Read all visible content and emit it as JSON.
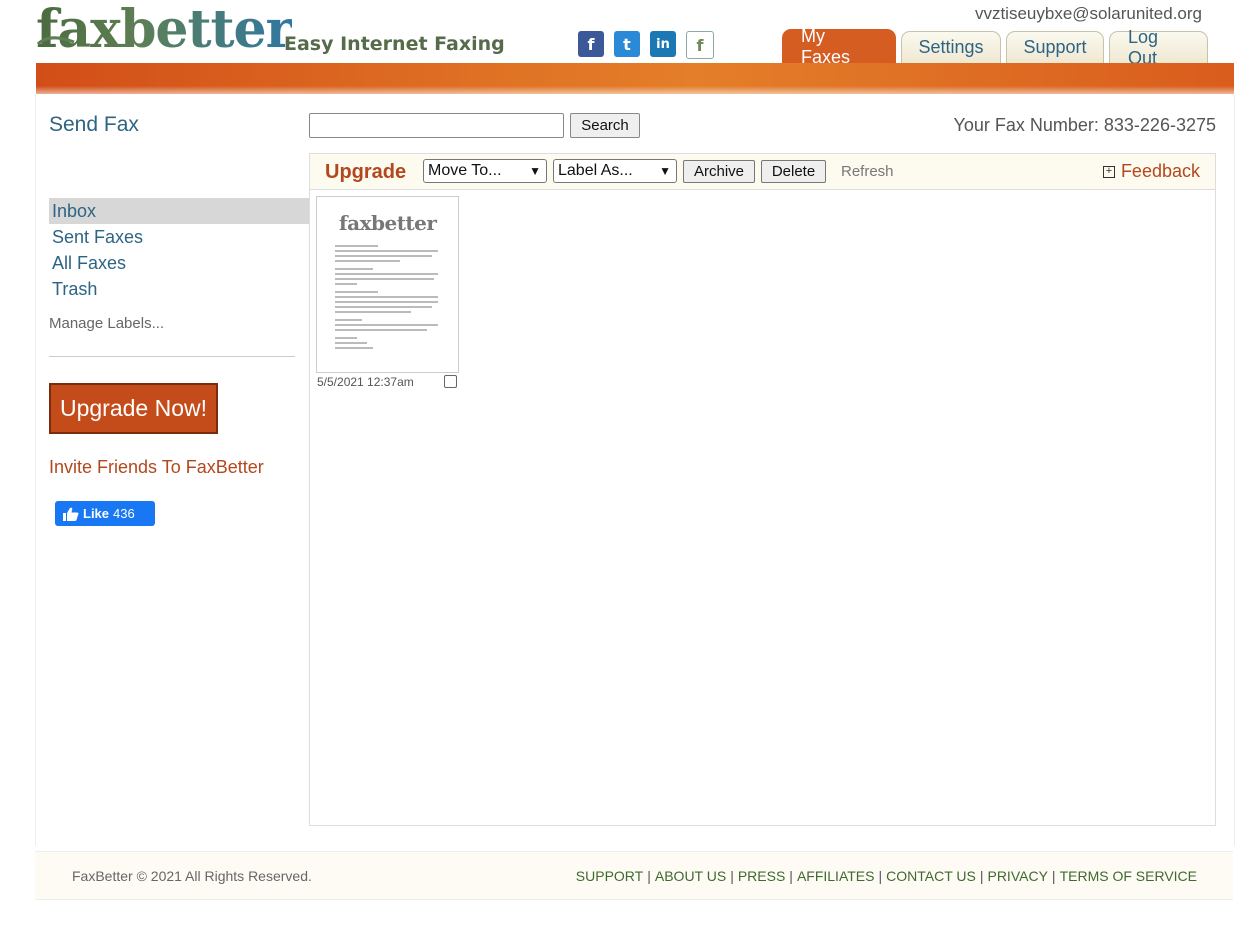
{
  "brand": {
    "name": "faxbetter",
    "tagline": "Easy Internet Faxing",
    "colors": {
      "accent": "#d55d22",
      "link": "#2e6483",
      "upgrade": "#c44b1a"
    }
  },
  "social": [
    {
      "name": "facebook-icon",
      "glyph": "f"
    },
    {
      "name": "twitter-icon",
      "glyph": "t"
    },
    {
      "name": "linkedin-icon",
      "glyph": "in"
    },
    {
      "name": "faxbetter-icon",
      "glyph": "f"
    }
  ],
  "user": {
    "email": "vvztiseuybxe@solarunited.org"
  },
  "tabs": [
    {
      "label": "My Faxes",
      "active": true
    },
    {
      "label": "Settings",
      "active": false
    },
    {
      "label": "Support",
      "active": false
    },
    {
      "label": "Log Out",
      "active": false
    }
  ],
  "sidebar": {
    "send_fax": "Send Fax",
    "nav": [
      {
        "label": "Inbox",
        "active": true
      },
      {
        "label": "Sent Faxes",
        "active": false
      },
      {
        "label": "All Faxes",
        "active": false
      },
      {
        "label": "Trash",
        "active": false
      }
    ],
    "manage_labels": "Manage Labels...",
    "upgrade_now": "Upgrade Now!",
    "invite": "Invite Friends To FaxBetter",
    "like": {
      "label": "Like",
      "count": "436"
    }
  },
  "search": {
    "value": "",
    "placeholder": "",
    "button": "Search"
  },
  "fax_number": "Your Fax Number: 833-226-3275",
  "toolbar": {
    "upgrade": "Upgrade",
    "move_to": "Move To...",
    "label_as": "Label As...",
    "archive": "Archive",
    "delete": "Delete",
    "refresh": "Refresh",
    "feedback_icon": "[+]",
    "feedback": "Feedback"
  },
  "faxes": [
    {
      "thumb_logo": "faxbetter",
      "date": "5/5/2021 12:37am",
      "checked": false
    }
  ],
  "footer": {
    "copyright": "FaxBetter © 2021 All Rights Reserved.",
    "links": [
      "SUPPORT",
      "ABOUT US",
      "PRESS",
      "AFFILIATES",
      "CONTACT US",
      "PRIVACY",
      "TERMS OF SERVICE"
    ]
  }
}
